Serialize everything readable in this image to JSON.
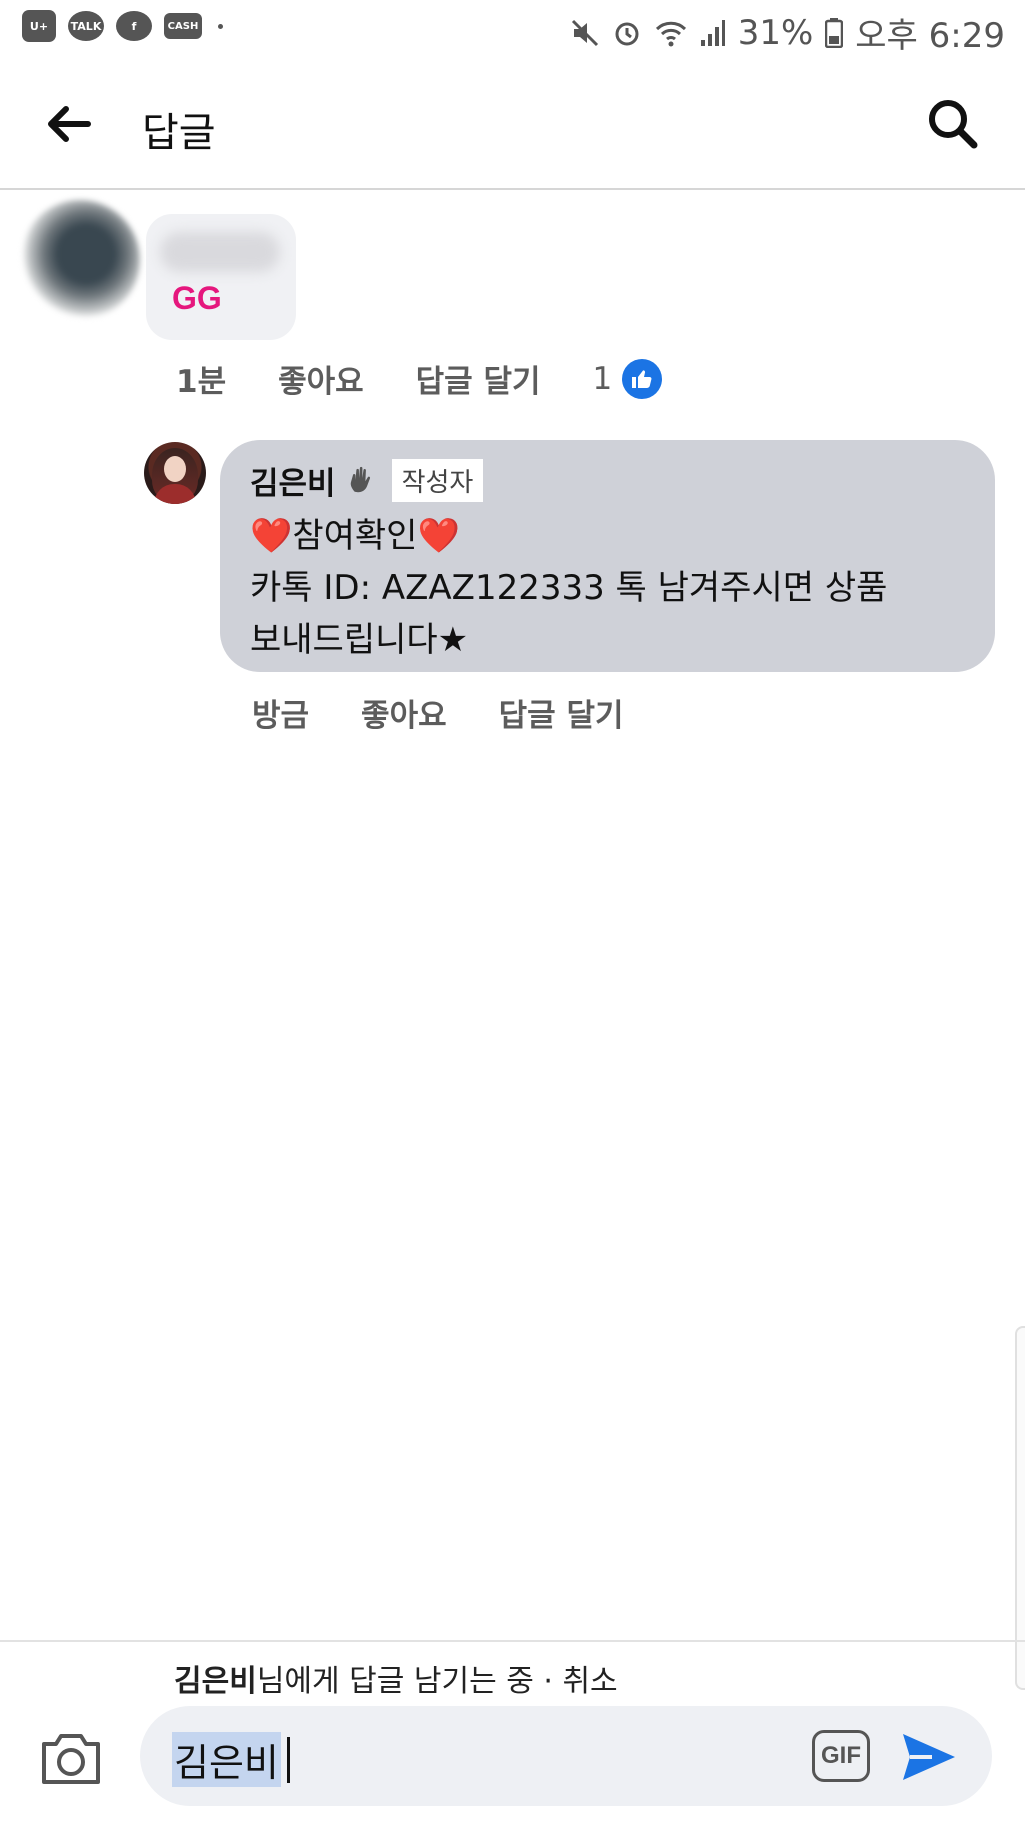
{
  "status_bar": {
    "left_icons": [
      "u-plus-icon",
      "kakao-talk-icon",
      "facebook-icon",
      "cash-icon",
      "more-dot-icon"
    ],
    "kakao_label": "TALK",
    "cash_label": "CASH",
    "battery": "31%",
    "time": "오후 6:29"
  },
  "header": {
    "title": "답글",
    "back_icon": "arrow-left-icon",
    "search_icon": "search-icon"
  },
  "comment": {
    "text": "GG",
    "time": "1분",
    "like_label": "좋아요",
    "reply_label": "답글 달기",
    "like_count": "1"
  },
  "reply": {
    "author": "김은비",
    "author_badge": "작성자",
    "line1": "참여확인",
    "line2": "카톡 ID: AZAZ122333 톡 남겨주시면 상품",
    "line3": "보내드립니다★",
    "heart": "❤️",
    "time": "방금",
    "like_label": "좋아요",
    "reply_label": "답글 달기"
  },
  "composer": {
    "replying_name": "김은비",
    "replying_suffix": "님에게 답글 남기는 중 · ",
    "cancel_label": "취소",
    "input_value": "김은비",
    "gif_label": "GIF"
  },
  "colors": {
    "accent": "#1b74e4",
    "bubble": "#cfd1d8",
    "gg": "#e5177d"
  }
}
